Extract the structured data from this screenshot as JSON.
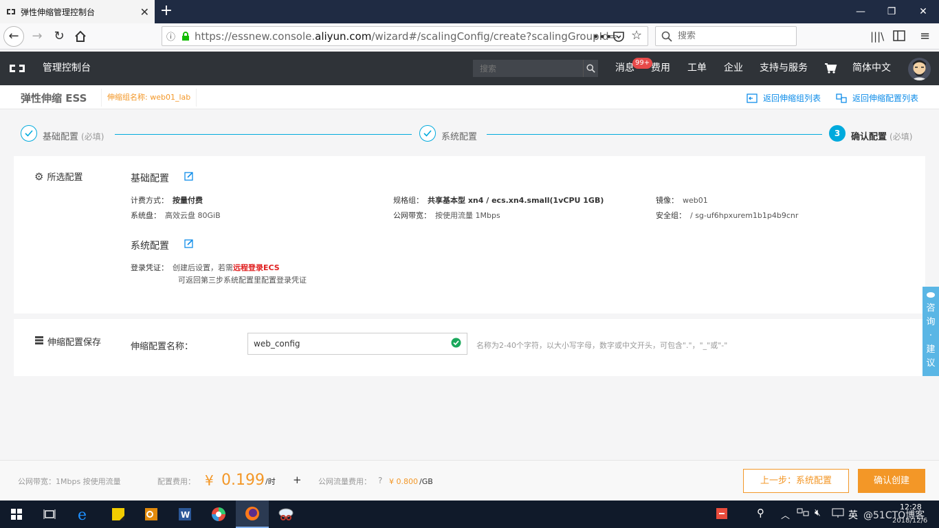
{
  "browser": {
    "tab_title": "弹性伸缩管理控制台",
    "url_prefix": "https://essnew.console.",
    "url_domain": "aliyun.com",
    "url_suffix": "/wizard#/scalingConfig/create?scalingGroupId=",
    "search_placeholder": "搜索"
  },
  "console": {
    "brand": "管理控制台",
    "search_placeholder": "搜索",
    "nav": {
      "messages": "消息",
      "messages_badge": "99+",
      "billing": "费用",
      "tickets": "工单",
      "enterprise": "企业",
      "support": "支持与服务",
      "language": "简体中文"
    }
  },
  "subheader": {
    "product": "弹性伸缩 ESS",
    "group_tag": "伸缩组名称: web01_lab",
    "back_group_list": "返回伸缩组列表",
    "back_config_list": "返回伸缩配置列表"
  },
  "steps": [
    {
      "label": "基础配置",
      "required": "(必填)",
      "state": "done"
    },
    {
      "label": "系统配置",
      "required": "",
      "state": "done"
    },
    {
      "number": "3",
      "label": "确认配置",
      "required": "(必填)",
      "state": "active"
    }
  ],
  "selected": {
    "section_title": "所选配置",
    "basic": {
      "title": "基础配置",
      "billing_label": "计费方式：",
      "billing_value": "按量付费",
      "spec_label": "规格组：",
      "spec_value": "共享基本型 xn4 / ecs.xn4.small(1vCPU 1GB)",
      "image_label": "镜像：",
      "image_value": "web01",
      "disk_label": "系统盘：",
      "disk_value": "高效云盘 80GiB",
      "bandwidth_label": "公网带宽：",
      "bandwidth_value": "按使用流量 1Mbps",
      "secgroup_label": "安全组：",
      "secgroup_value": "/ sg-uf6hpxurem1b1p4b9cnr"
    },
    "system": {
      "title": "系统配置",
      "cred_label": "登录凭证：",
      "cred_text1": "创建后设置，若需",
      "cred_link": "远程登录ECS",
      "cred_text2": "可返回第三步系统配置里配置登录凭证"
    }
  },
  "save": {
    "section_title": "伸缩配置保存",
    "name_label": "伸缩配置名称：",
    "name_value": "web_config",
    "hint": "名称为2-40个字符，以大小写字母，数字或中文开头，可包含\".\"，\"_\"或\"-\""
  },
  "footer": {
    "bandwidth": "公网带宽：1Mbps 按使用流量",
    "cost_label": "配置费用：",
    "currency": "¥",
    "price": "0.199",
    "per_hour": "/时",
    "plus": "+",
    "traffic_label": "公网流量费用：",
    "traffic_price": "¥ 0.800",
    "per_gb": "/GB",
    "prev_button": "上一步：系统配置",
    "create_button": "确认创建"
  },
  "feedback": [
    "咨",
    "询",
    "·",
    "建",
    "议"
  ],
  "taskbar": {
    "time": "12:28",
    "date": "2018/12/6",
    "ime": "英",
    "watermark": "@51CTO博客"
  },
  "colors": {
    "accent_orange": "#f39727",
    "step_blue": "#00aadd",
    "link_blue": "#0f8de9",
    "header_dark": "#2f3338"
  }
}
